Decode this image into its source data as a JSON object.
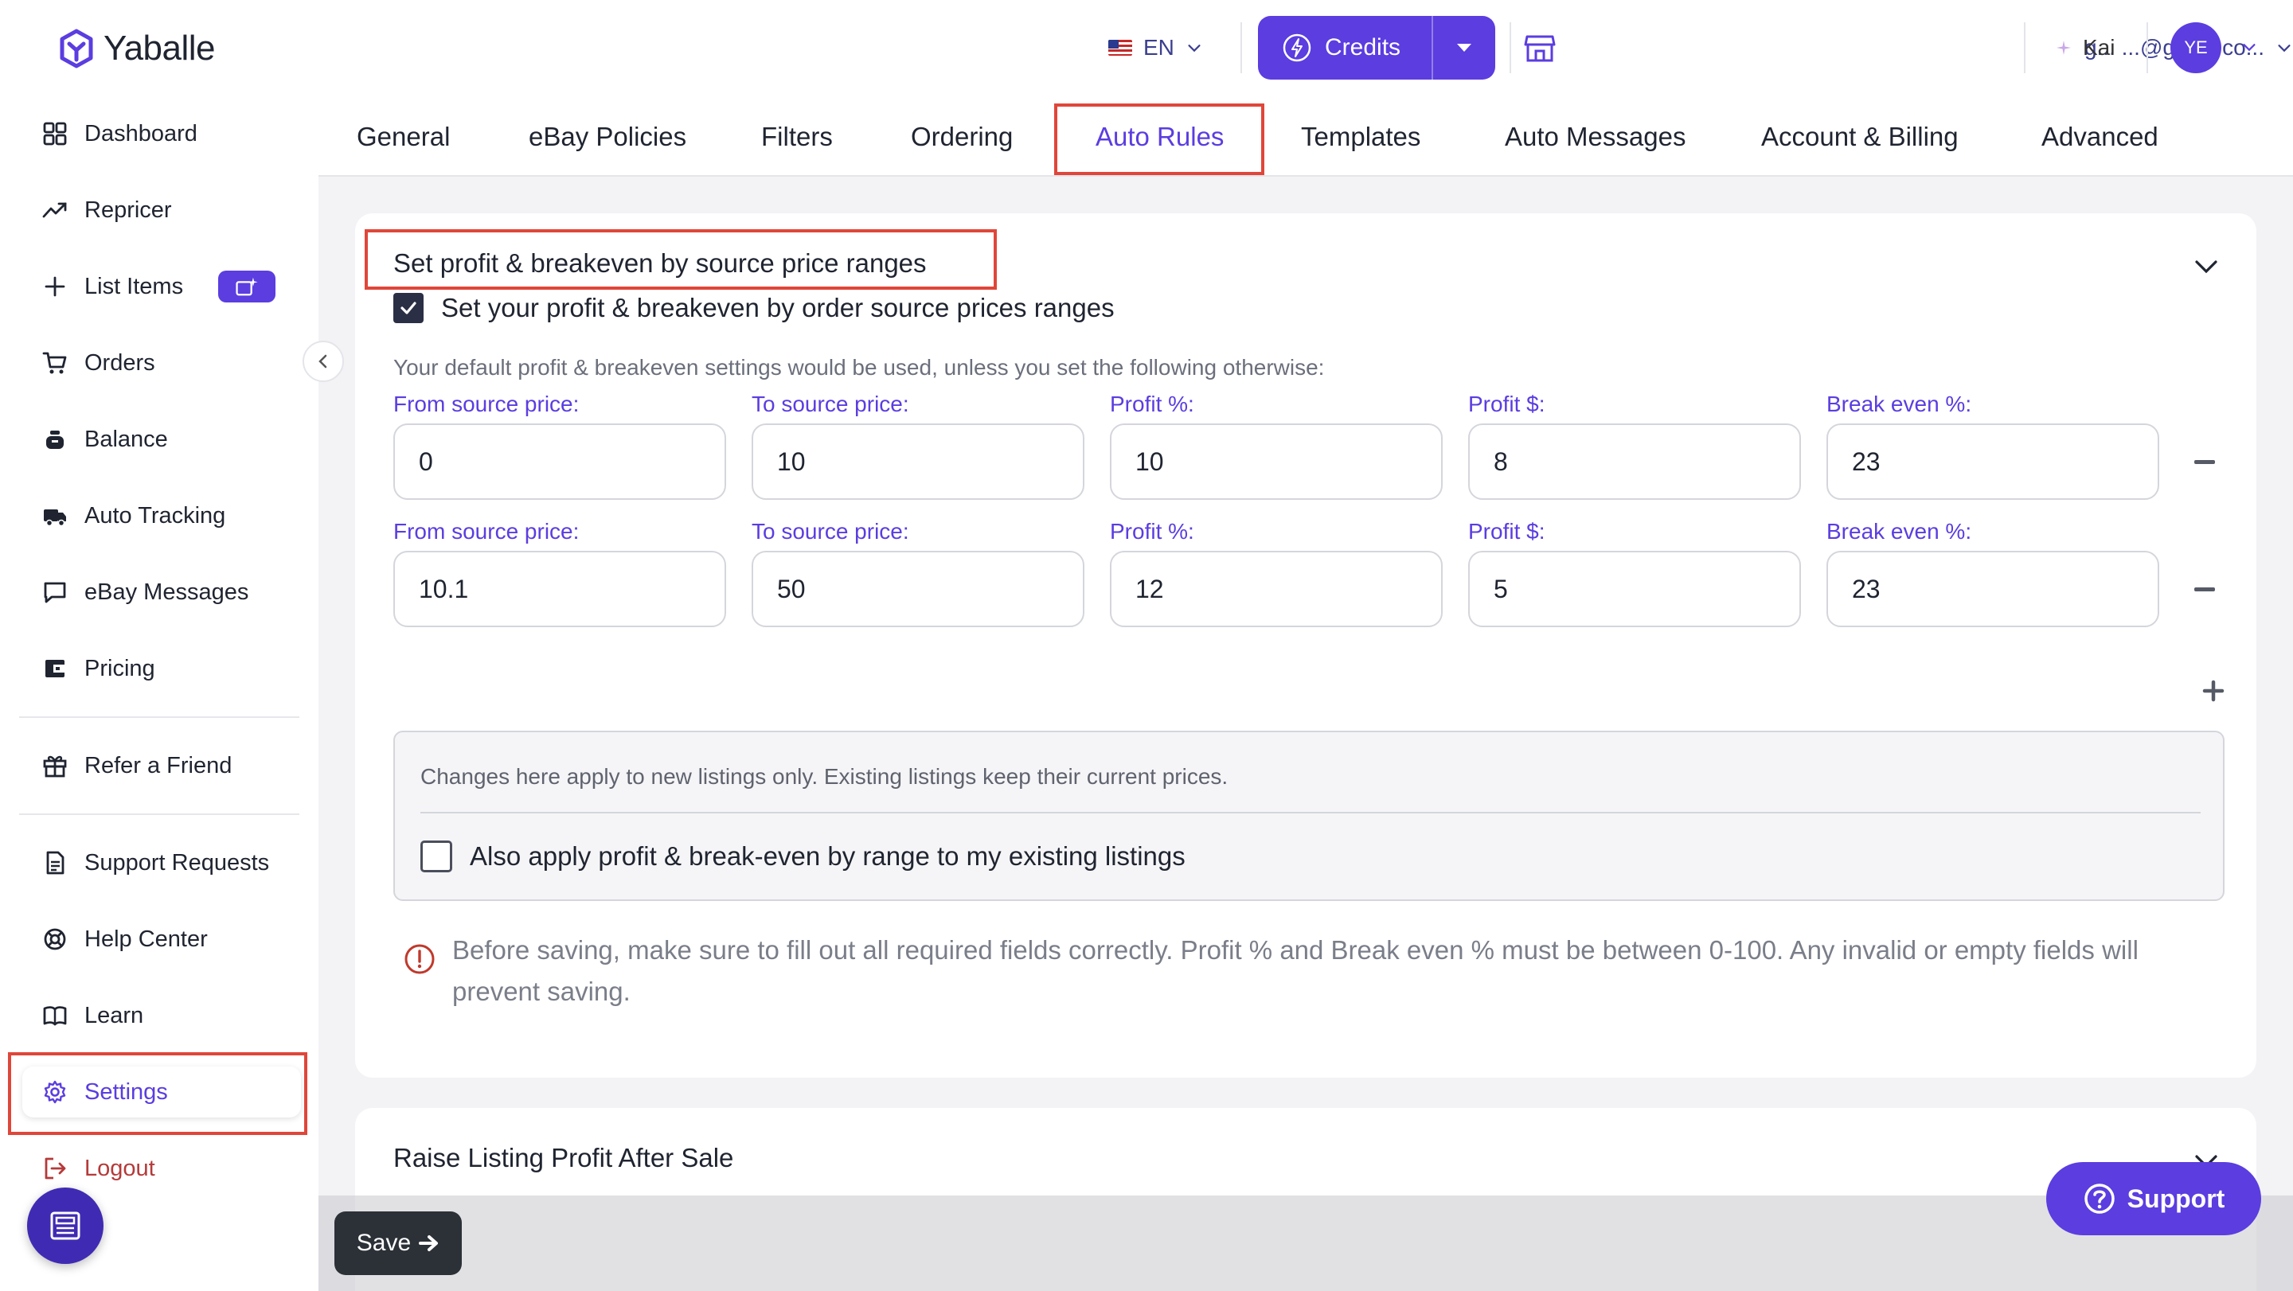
{
  "app": {
    "logo_text": "Yaballe"
  },
  "header": {
    "language": "EN",
    "credits_label": "Credits",
    "email": "g... ...@gmail.co...",
    "kai_label": "Kai",
    "avatar_initials": "YE"
  },
  "sidebar": {
    "items": [
      {
        "label": "Dashboard",
        "icon": "dashboard-icon"
      },
      {
        "label": "Repricer",
        "icon": "trend-up-icon"
      },
      {
        "label": "List Items",
        "icon": "plus-icon"
      },
      {
        "label": "Orders",
        "icon": "cart-icon"
      },
      {
        "label": "Balance",
        "icon": "money-bag-icon"
      },
      {
        "label": "Auto Tracking",
        "icon": "truck-icon"
      },
      {
        "label": "eBay Messages",
        "icon": "chat-icon"
      },
      {
        "label": "Pricing",
        "icon": "wallet-icon"
      },
      {
        "label": "Refer a Friend",
        "icon": "gift-icon"
      },
      {
        "label": "Support Requests",
        "icon": "document-icon"
      },
      {
        "label": "Help Center",
        "icon": "lifebuoy-icon"
      },
      {
        "label": "Learn",
        "icon": "book-icon"
      },
      {
        "label": "Settings",
        "icon": "gear-icon"
      },
      {
        "label": "Logout",
        "icon": "logout-icon"
      }
    ]
  },
  "tabs": [
    {
      "label": "General"
    },
    {
      "label": "eBay Policies"
    },
    {
      "label": "Filters"
    },
    {
      "label": "Ordering"
    },
    {
      "label": "Auto Rules",
      "active": true
    },
    {
      "label": "Templates"
    },
    {
      "label": "Auto Messages"
    },
    {
      "label": "Account & Billing"
    },
    {
      "label": "Advanced"
    }
  ],
  "section": {
    "title": "Set profit & breakeven by source price ranges",
    "enable_label": "Set your profit & breakeven by order source prices ranges",
    "enabled": true,
    "default_note": "Your default profit & breakeven settings would be used, unless you set the following otherwise:",
    "field_labels": {
      "from": "From source price:",
      "to": "To source price:",
      "profit_pct": "Profit %:",
      "profit_usd": "Profit $:",
      "breakeven": "Break even %:"
    },
    "ranges": [
      {
        "from": "0",
        "to": "10",
        "profit_pct": "10",
        "profit_usd": "8",
        "breakeven": "23"
      },
      {
        "from": "10.1",
        "to": "50",
        "profit_pct": "12",
        "profit_usd": "5",
        "breakeven": "23"
      }
    ],
    "apply_note": "Changes here apply to new listings only. Existing listings keep their current prices.",
    "apply_existing_label": "Also apply profit & break-even by range to my existing listings",
    "apply_existing": false,
    "warning": "Before saving, make sure to fill out all required fields correctly. Profit % and Break even % must be between 0-100. Any invalid or empty fields will prevent saving."
  },
  "section2": {
    "title": "Raise Listing Profit After Sale"
  },
  "footer": {
    "save_label": "Save",
    "support_label": "Support"
  },
  "colors": {
    "accent": "#5b3de0",
    "highlight": "#e0463a",
    "logout": "#b53a3a"
  }
}
